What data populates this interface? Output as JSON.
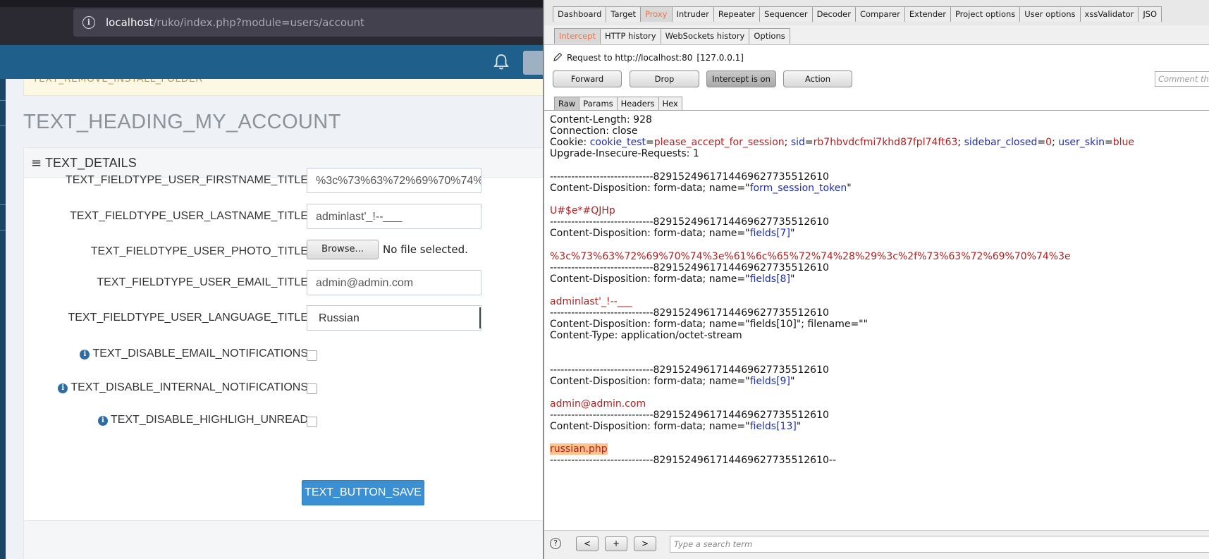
{
  "browser": {
    "url_host": "localhost",
    "url_path": "/ruko/index.php?module=users/account"
  },
  "page": {
    "alert_text": "TEXT_REMOVE_INSTALL_FOLDER",
    "heading": "TEXT_HEADING_MY_ACCOUNT",
    "panel_title": "TEXT_DETAILS",
    "fields": {
      "firstname_label": "TEXT_FIELDTYPE_USER_FIRSTNAME_TITLE",
      "firstname_value": "%3c%73%63%72%69%70%74%3e%61%6c%65%72%74%28%29%3c%2f%73%63%72%69%70%74%3e",
      "lastname_label": "TEXT_FIELDTYPE_USER_LASTNAME_TITLE",
      "lastname_value": "adminlast'_!--___",
      "photo_label": "TEXT_FIELDTYPE_USER_PHOTO_TITLE",
      "browse_label": "Browse...",
      "no_file": "No file selected.",
      "email_label": "TEXT_FIELDTYPE_USER_EMAIL_TITLE",
      "email_value": "admin@admin.com",
      "language_label": "TEXT_FIELDTYPE_USER_LANGUAGE_TITLE",
      "language_value": "Russian",
      "disable_email_label": "TEXT_DISABLE_EMAIL_NOTIFICATIONS",
      "disable_internal_label": "TEXT_DISABLE_INTERNAL_NOTIFICATIONS",
      "disable_highlight_label": "TEXT_DISABLE_HIGHLIGH_UNREAD"
    },
    "save_button": "TEXT_BUTTON_SAVE"
  },
  "burp": {
    "main_tabs": [
      "Dashboard",
      "Target",
      "Proxy",
      "Intruder",
      "Repeater",
      "Sequencer",
      "Decoder",
      "Comparer",
      "Extender",
      "Project options",
      "User options",
      "xssValidator",
      "JSO"
    ],
    "active_main_tab": "Proxy",
    "proxy_tabs": [
      "Intercept",
      "HTTP history",
      "WebSockets history",
      "Options"
    ],
    "request_to": "Request to http://localhost:80",
    "request_ip": "[127.0.0.1]",
    "buttons": {
      "forward": "Forward",
      "drop": "Drop",
      "intercept": "Intercept is on",
      "action": "Action"
    },
    "comment_placeholder": "Comment th",
    "request_tabs": [
      "Raw",
      "Params",
      "Headers",
      "Hex"
    ],
    "message": {
      "content_length": "Content-Length: 928",
      "connection": "Connection: close",
      "cookie_prefix": "Cookie: ",
      "cookie_1_name": "cookie_test",
      "cookie_1_value": "please_accept_for_session",
      "cookie_2_name": "sid",
      "cookie_2_value": "rb7hbvdcfmi7khd87fpl74ft63",
      "cookie_3_name": "sidebar_closed",
      "cookie_3_value": "0",
      "cookie_4_name": "user_skin",
      "cookie_4_value": "blue",
      "upgrade": "Upgrade-Insecure-Requests: 1",
      "boundary": "-----------------------------829152496171446962773551261​0",
      "boundary_end": "-----------------------------829152496171446962773551261​0--",
      "cd_prefix": "Content-Disposition: form-data; name=\"",
      "part_1_name": "form_session_token",
      "part_1_value": "U#$e*#QJHp",
      "part_2_name": "fields[7]",
      "part_2_value": "%3c%73%63%72%69%70%74%3e%61%6c%65%72%74%28%29%3c%2f%73%63%72%69%70%74%3e",
      "part_3_name": "fields[8]",
      "part_3_value": "adminlast'_!--___",
      "part_4_line": "Content-Disposition: form-data; name=\"fields[10]\"; filename=\"\"",
      "part_4_type": "Content-Type: application/octet-stream",
      "part_5_name": "fields[9]",
      "part_5_value": "admin@admin.com",
      "part_6_name": "fields[13]",
      "part_6_value": "russian.php"
    },
    "nav": {
      "prev": "<",
      "add": "+",
      "next": ">"
    },
    "search_placeholder": "Type a search term"
  }
}
